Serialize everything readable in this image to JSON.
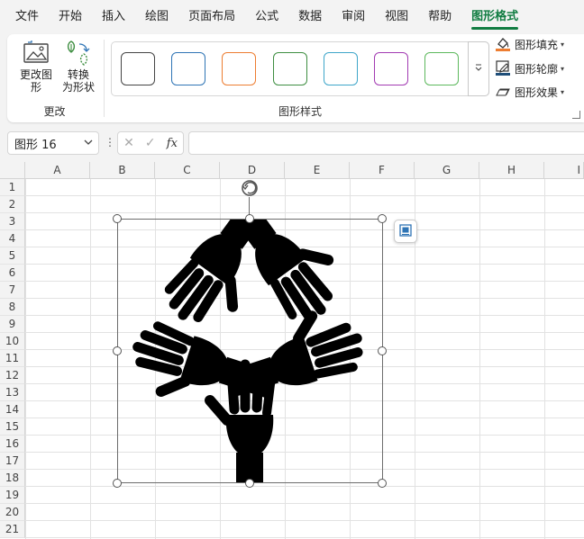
{
  "menu": {
    "tabs": [
      "文件",
      "开始",
      "插入",
      "绘图",
      "页面布局",
      "公式",
      "数据",
      "审阅",
      "视图",
      "帮助",
      "图形格式"
    ],
    "active_index": 10
  },
  "ribbon": {
    "change_group": {
      "change_shape_label": "更改图\n形",
      "convert_label": "转换\n为形状",
      "group_label": "更改"
    },
    "styles_group": {
      "group_label": "图形样式",
      "swatch_colors": [
        "#444444",
        "#2e74b5",
        "#ed7d31",
        "#3e8e41",
        "#3ea6c9",
        "#a23ab2",
        "#5cb85c"
      ]
    },
    "format_items": {
      "fill": "图形填充",
      "outline": "图形轮廓",
      "effects": "图形效果"
    }
  },
  "formula_bar": {
    "name_box": "图形 16",
    "fx_label": "fx",
    "formula_value": ""
  },
  "sheet": {
    "columns": [
      "A",
      "B",
      "C",
      "D",
      "E",
      "F",
      "G",
      "H",
      "I"
    ],
    "rows": [
      "1",
      "2",
      "3",
      "4",
      "5",
      "6",
      "7",
      "8",
      "9",
      "10",
      "11",
      "12",
      "13",
      "14",
      "15",
      "16",
      "17",
      "18",
      "19",
      "20",
      "21"
    ]
  },
  "colors": {
    "accent": "#107c41",
    "shape_fill": "#000000"
  },
  "icons": {
    "change_shape": "change-graphic-icon",
    "convert": "convert-to-shape-icon",
    "rotate": "rotate-handle-icon",
    "layout_options": "layout-options-icon"
  }
}
